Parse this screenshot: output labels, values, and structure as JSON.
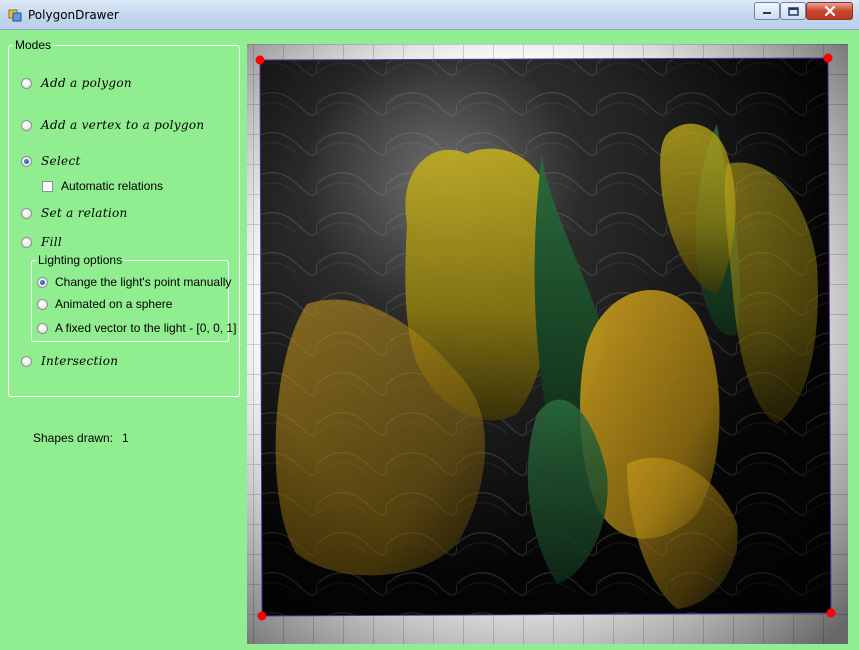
{
  "window": {
    "title": "PolygonDrawer"
  },
  "modes": {
    "legend": "Modes",
    "items": [
      {
        "label": "Add a polygon",
        "checked": false
      },
      {
        "label": "Add a vertex to a polygon",
        "checked": false
      },
      {
        "label": "Select",
        "checked": true
      },
      {
        "label": "Set a relation",
        "checked": false
      },
      {
        "label": "Fill",
        "checked": false
      },
      {
        "label": "Intersection",
        "checked": false
      }
    ],
    "automatic_relations": {
      "label": "Automatic relations",
      "checked": false
    }
  },
  "lighting": {
    "legend": "Lighting options",
    "items": [
      {
        "label": "Change the light's point manually",
        "checked": true
      },
      {
        "label": "Animated on a sphere",
        "checked": false
      },
      {
        "label": "A fixed vector to the light - [0, 0, 1]",
        "checked": false
      }
    ]
  },
  "status": {
    "shapes_drawn_label": "Shapes drawn:",
    "shapes_drawn_value": "1"
  },
  "colors": {
    "background": "#90EE90",
    "vertex": "#ff0000",
    "polygon_edge": "#5a2ca0"
  }
}
